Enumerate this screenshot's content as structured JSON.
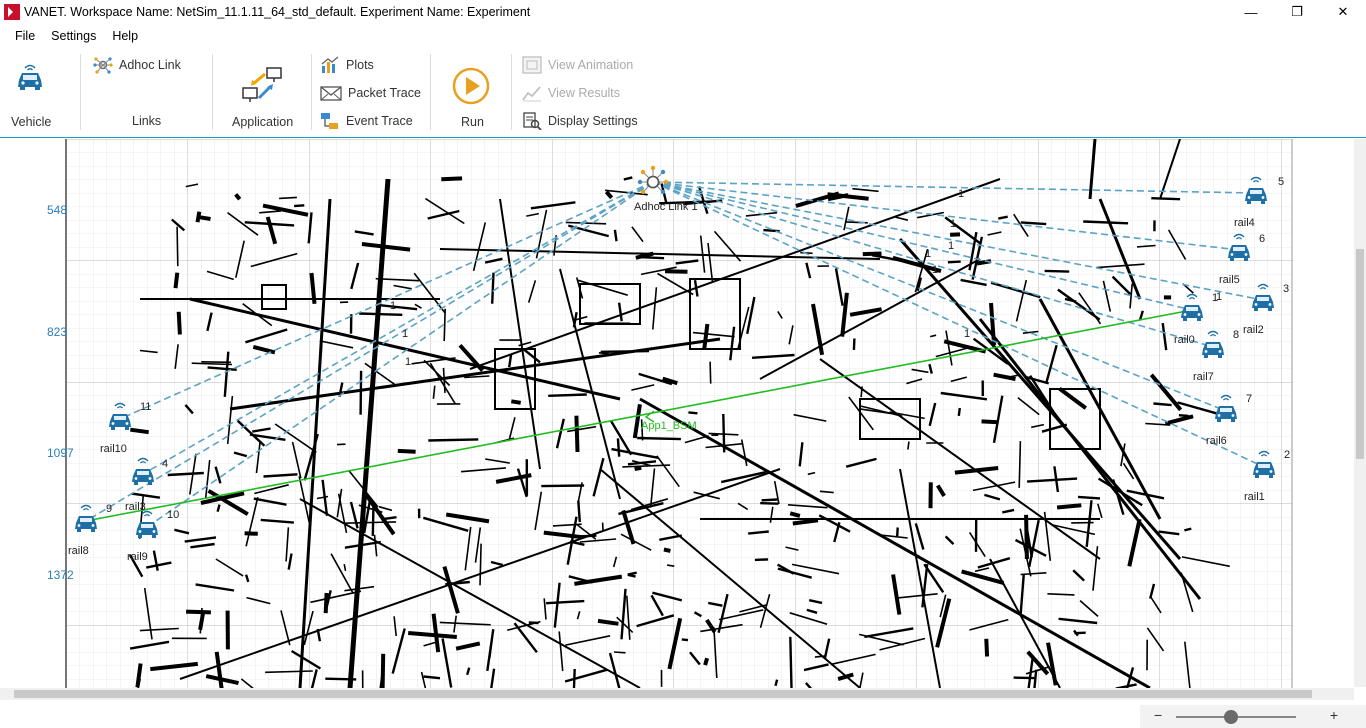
{
  "window": {
    "title": "VANET. Workspace Name: NetSim_11.1.11_64_std_default. Experiment Name: Experiment",
    "minimize": "—",
    "maximize": "❐",
    "close": "✕"
  },
  "menu": {
    "items": [
      "File",
      "Settings",
      "Help"
    ]
  },
  "ribbon": {
    "vehicle_label": "Vehicle",
    "adhoc_link_label": "Adhoc Link",
    "links_group_label": "Links",
    "application_label": "Application",
    "plots_label": "Plots",
    "packet_trace_label": "Packet Trace",
    "event_trace_label": "Event Trace",
    "run_label": "Run",
    "view_animation_label": "View Animation",
    "view_results_label": "View Results",
    "display_settings_label": "Display Settings"
  },
  "canvas": {
    "y_ticks": [
      "548",
      "823",
      "1097",
      "1372"
    ],
    "adhoc_link": {
      "label": "Adhoc Link 1"
    },
    "app_label": "App1_BSM",
    "vehicles": [
      {
        "name": "rail4",
        "id": "5"
      },
      {
        "name": "rail5",
        "id": "6"
      },
      {
        "name": "rail2",
        "id": "3"
      },
      {
        "name": "rail0",
        "id": "1"
      },
      {
        "name": "rail7",
        "id": "8"
      },
      {
        "name": "rail6",
        "id": "7"
      },
      {
        "name": "rail1",
        "id": "2"
      },
      {
        "name": "rail10",
        "id": "11"
      },
      {
        "name": "rail3",
        "id": "4"
      },
      {
        "name": "rail8",
        "id": "9"
      },
      {
        "name": "rail9",
        "id": "10"
      }
    ],
    "link_numbers": [
      "1",
      "1",
      "1",
      "1",
      "1",
      "1",
      "1",
      "1",
      "1",
      "1"
    ]
  },
  "colors": {
    "accent": "#17a0b8",
    "vehicle_blue": "#1d6fa5",
    "link_dashed": "#5ba3c4",
    "app_line": "#22bb22",
    "tick_blue": "#2a7fb8"
  },
  "zoom": {
    "minus": "−",
    "plus": "+"
  }
}
